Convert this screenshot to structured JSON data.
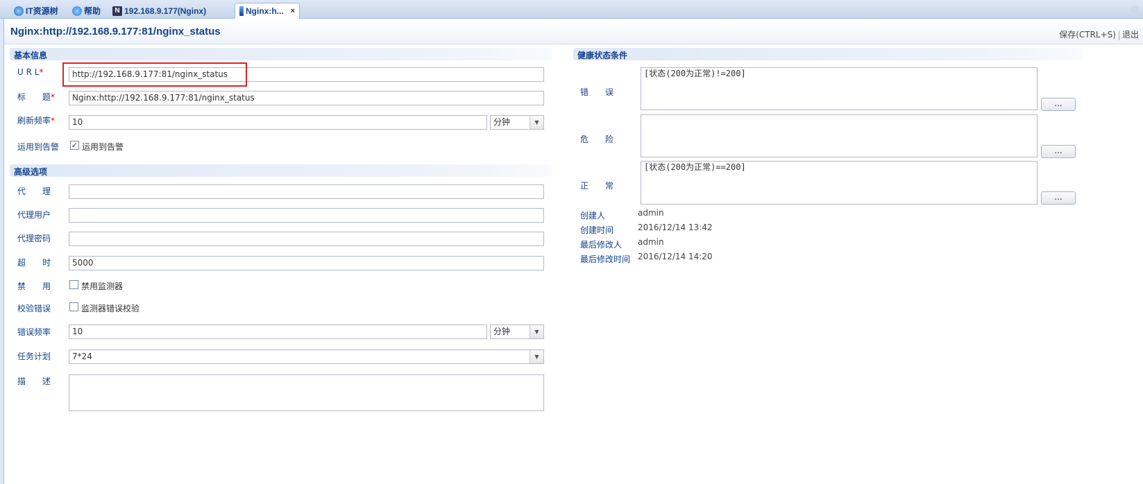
{
  "tabs": [
    {
      "label": "IT资源树"
    },
    {
      "label": "帮助"
    },
    {
      "label": "192.168.9.177(Nginx)"
    },
    {
      "label": "Nginx:h...",
      "close": "×"
    }
  ],
  "header": {
    "title": "Nginx:http://192.168.9.177:81/nginx_status",
    "save_label": "保存(CTRL+S)",
    "exit_label": "退出"
  },
  "basic": {
    "section_title": "基本信息",
    "url_label": "U R L",
    "url_value": "http://192.168.9.177:81/nginx_status",
    "title_label": "标　　题",
    "title_value": "Nginx:http://192.168.9.177:81/nginx_status",
    "refresh_label": "刷新频率",
    "refresh_value": "10",
    "refresh_unit": "分钟",
    "apply_label": "运用到告警",
    "apply_checkbox_label": "运用到告警",
    "required_mark": "*"
  },
  "advanced": {
    "section_title": "高级选项",
    "proxy_label": "代　　理",
    "proxy_user_label": "代理用户",
    "proxy_pass_label": "代理密码",
    "timeout_label": "超　　时",
    "timeout_value": "5000",
    "disable_label": "禁　　用",
    "disable_checkbox_label": "禁用监测器",
    "verify_label": "校验错误",
    "verify_checkbox_label": "监测器错误校验",
    "error_freq_label": "错误频率",
    "error_freq_value": "10",
    "error_freq_unit": "分钟",
    "schedule_label": "任务计划",
    "schedule_value": "7*24",
    "desc_label": "描　　述"
  },
  "health": {
    "section_title": "健康状态条件",
    "error_label": "错　　误",
    "error_value": "[状态(200为正常)!=200]",
    "danger_label": "危　　险",
    "danger_value": "",
    "normal_label": "正　　常",
    "normal_value": "[状态(200为正常)==200]",
    "button_label": "...",
    "created_by_label": "创建人",
    "created_by": "admin",
    "created_time_label": "创建时间",
    "created_time": "2016/12/14 13:42",
    "modified_by_label": "最后修改人",
    "modified_by": "admin",
    "modified_time_label": "最后修改时间",
    "modified_time": "2016/12/14 14:20"
  }
}
